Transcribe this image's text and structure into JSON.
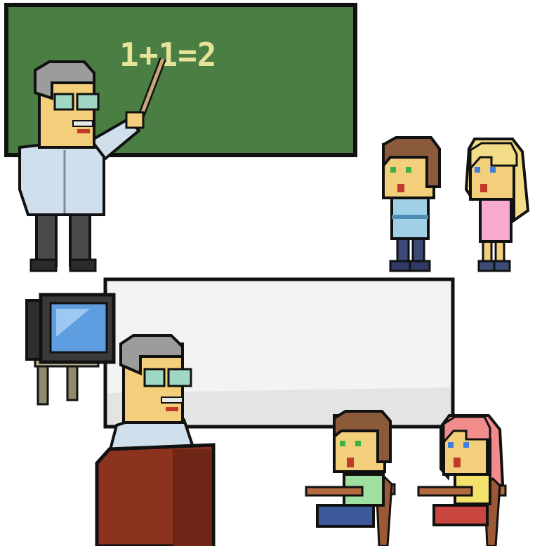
{
  "chalkboard": {
    "equation": "1+1=2",
    "board_color": "#4a7e43",
    "chalk_color": "#e8e39a"
  },
  "whiteboard": {
    "color": "#f3f3f3"
  },
  "tv": {
    "screen_color": "#5e9de0"
  },
  "palette": {
    "skin": "#f4cf7b",
    "hair_gray": "#9c9c9c",
    "shirt_teacher": "#cfe0ec",
    "pants_dark": "#4a4a4a",
    "glasses": "#9fd7c4",
    "podium": "#8c3320",
    "hair_brown": "#8a5a3a",
    "hair_blonde": "#f3dc88",
    "hair_pink": "#f28c8c",
    "boy_shirt": "#9fd0e6",
    "girl_dress": "#f7a9cf",
    "boy_shirt_green": "#9fe0a0",
    "girl_shirt_yellow": "#f2e16b",
    "desk": "#9b5a35"
  }
}
